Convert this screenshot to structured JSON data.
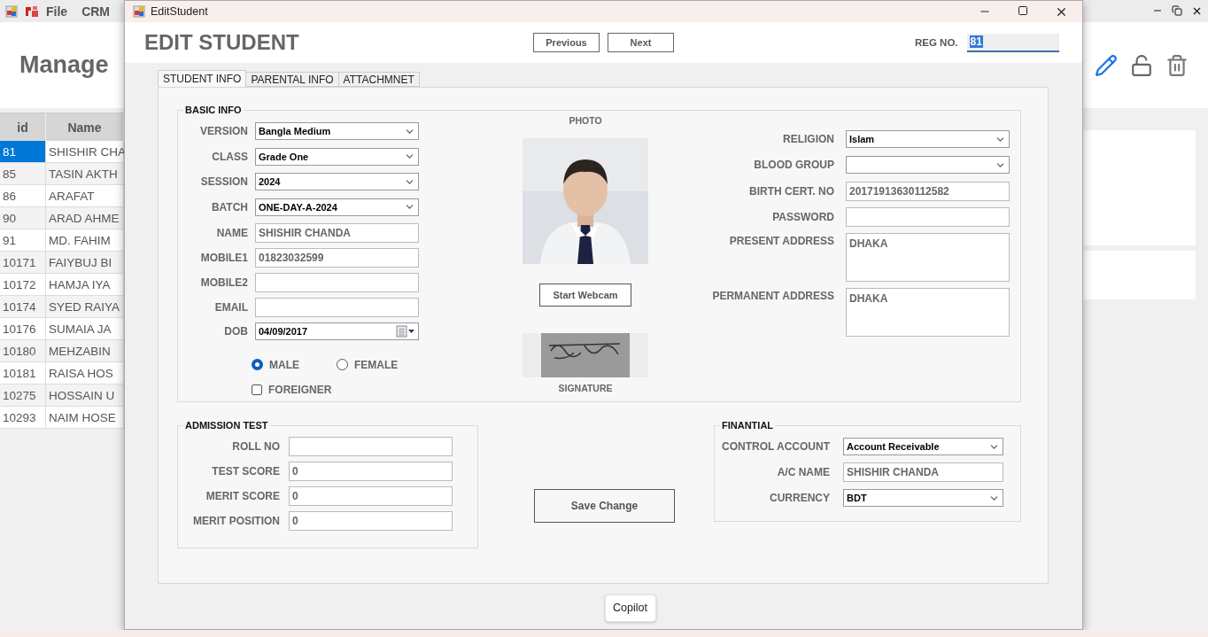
{
  "background_app": {
    "menu": [
      "File",
      "CRM"
    ],
    "heading": "Manage",
    "table": {
      "columns": [
        "id",
        "Name"
      ],
      "rows": [
        {
          "id": "81",
          "name": "SHISHIR CHA",
          "selected": true
        },
        {
          "id": "85",
          "name": "TASIN AKTH",
          "selected": false
        },
        {
          "id": "86",
          "name": "ARAFAT",
          "selected": false
        },
        {
          "id": "90",
          "name": "ARAD AHME",
          "selected": false
        },
        {
          "id": "91",
          "name": "MD. FAHIM",
          "selected": false
        },
        {
          "id": "10171",
          "name": "FAIYBUJ BI",
          "selected": false
        },
        {
          "id": "10172",
          "name": "HAMJA IYA",
          "selected": false
        },
        {
          "id": "10174",
          "name": "SYED RAIYA",
          "selected": false
        },
        {
          "id": "10176",
          "name": "SUMAIA JA",
          "selected": false
        },
        {
          "id": "10180",
          "name": "MEHZABIN",
          "selected": false
        },
        {
          "id": "10181",
          "name": "RAISA HOS",
          "selected": false
        },
        {
          "id": "10275",
          "name": "HOSSAIN U",
          "selected": false
        },
        {
          "id": "10293",
          "name": "NAIM HOSE",
          "selected": false
        }
      ]
    }
  },
  "dialog": {
    "title": "EditStudent",
    "heading": "EDIT STUDENT",
    "nav_buttons": [
      "Previous",
      "Next"
    ],
    "reg_no": {
      "label": "REG NO.",
      "value": "81"
    },
    "tabs": [
      {
        "label": "STUDENT INFO",
        "selected": true
      },
      {
        "label": "PARENTAL INFO",
        "selected": false
      },
      {
        "label": "ATTACHMNET",
        "selected": false
      }
    ],
    "basic_info": {
      "title": "BASIC INFO",
      "left_fields": [
        {
          "label": "VERSION",
          "kind": "dropdown",
          "value": "Bangla Medium"
        },
        {
          "label": "CLASS",
          "kind": "dropdown",
          "value": "Grade One"
        },
        {
          "label": "SESSION",
          "kind": "dropdown",
          "value": "2024"
        },
        {
          "label": "BATCH",
          "kind": "dropdown",
          "value": "ONE-DAY-A-2024"
        },
        {
          "label": "NAME",
          "kind": "text",
          "value": "SHISHIR CHANDA"
        },
        {
          "label": "MOBILE1",
          "kind": "text",
          "value": "01823032599"
        },
        {
          "label": "MOBILE2",
          "kind": "text"
        },
        {
          "label": "EMAIL",
          "kind": "text"
        },
        {
          "label": "DOB",
          "kind": "date",
          "value": "04/09/2017"
        }
      ],
      "gender": [
        {
          "label": "MALE",
          "selected": true
        },
        {
          "label": "FEMALE",
          "selected": false
        }
      ],
      "foreigner": {
        "label": "FOREIGNER",
        "checked": false
      },
      "photo_label": "PHOTO",
      "webcam_button": "Start Webcam",
      "signature_label": "SIGNATURE",
      "right_fields": [
        {
          "label": "RELIGION",
          "kind": "dropdown",
          "value": "Islam"
        },
        {
          "label": "BLOOD GROUP",
          "kind": "dropdown"
        },
        {
          "label": "BIRTH CERT. NO",
          "kind": "text",
          "value": "20171913630112582"
        },
        {
          "label": "PASSWORD",
          "kind": "text"
        },
        {
          "label": "PRESENT ADDRESS",
          "kind": "textarea",
          "value": "DHAKA"
        },
        {
          "label": "PERMANENT ADDRESS",
          "kind": "textarea",
          "value": "DHAKA"
        }
      ]
    },
    "admission_test": {
      "title": "ADMISSION TEST",
      "fields": [
        {
          "label": "ROLL NO",
          "kind": "text"
        },
        {
          "label": "TEST SCORE",
          "kind": "text",
          "value": "0"
        },
        {
          "label": "MERIT SCORE",
          "kind": "text",
          "value": "0"
        },
        {
          "label": "MERIT POSITION",
          "kind": "text",
          "value": "0"
        }
      ]
    },
    "save_button": "Save Change",
    "financial": {
      "title": "FINANTIAL",
      "fields": [
        {
          "label": "CONTROL ACCOUNT",
          "kind": "dropdown",
          "value": "Account Receivable"
        },
        {
          "label": "A/C NAME",
          "kind": "text",
          "value": "SHISHIR CHANDA"
        },
        {
          "label": "CURRENCY",
          "kind": "dropdown",
          "value": "BDT"
        }
      ]
    },
    "copilot_button": "Copilot"
  }
}
